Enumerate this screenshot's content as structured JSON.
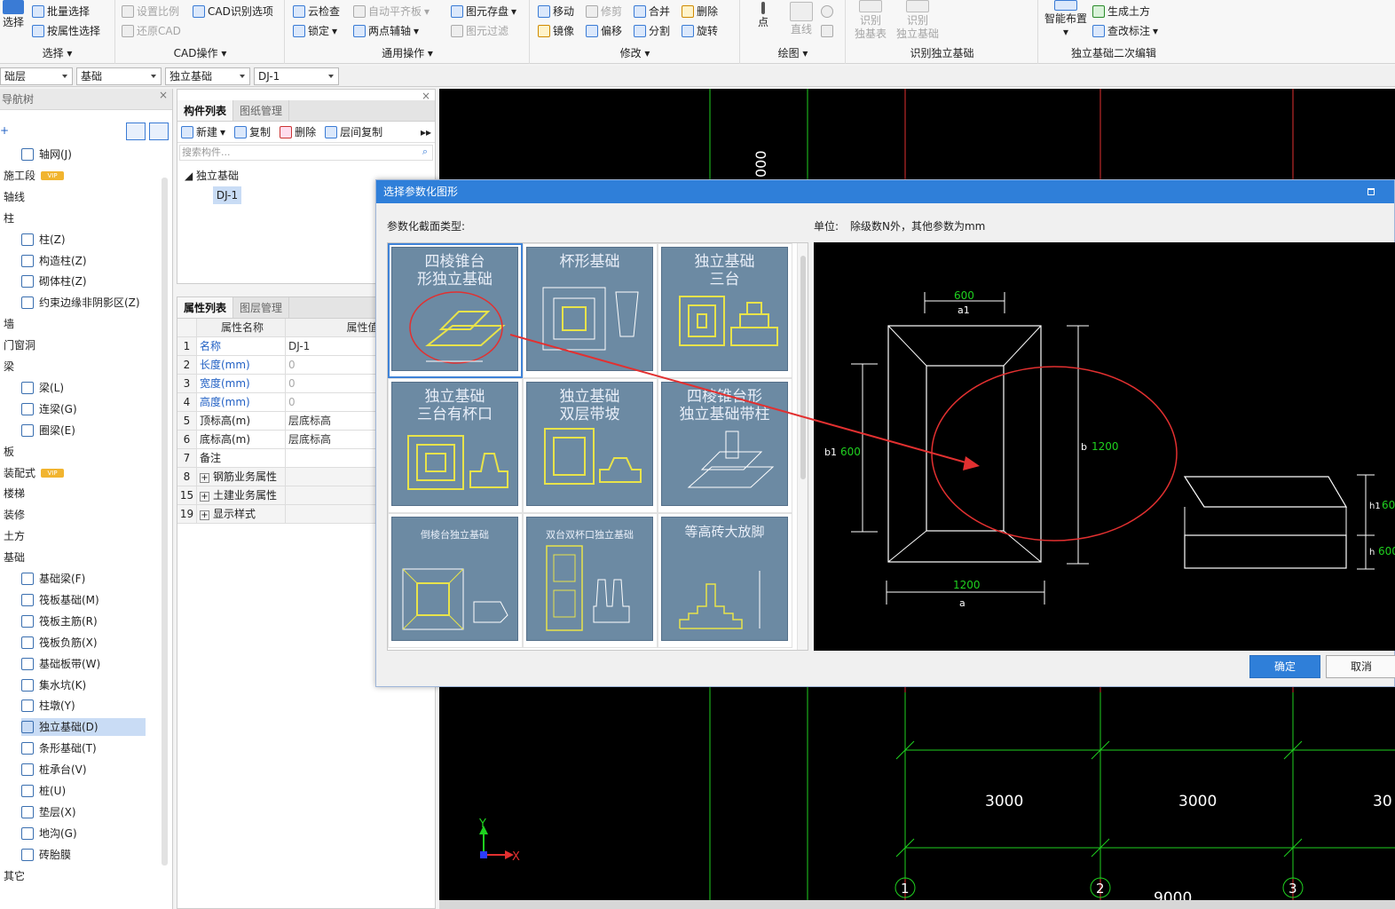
{
  "ribbon": {
    "select_group": {
      "title": "选择",
      "select_btn": "选择",
      "batch_select": "批量选择",
      "attr_select": "按属性选择"
    },
    "cad_group": {
      "title": "CAD操作",
      "set_ratio": "设置比例",
      "restore_cad": "还原CAD",
      "cad_options": "CAD识别选项"
    },
    "general_group": {
      "title": "通用操作",
      "cloud_check": "云检查",
      "lock": "锁定",
      "auto_level": "自动平齐板",
      "two_point_axis": "两点辅轴",
      "elem_save": "图元存盘",
      "elem_filter": "图元过滤"
    },
    "modify_group": {
      "title": "修改",
      "move": "移动",
      "trim": "修剪",
      "merge": "合并",
      "delete": "删除",
      "mirror": "镜像",
      "offset": "偏移",
      "split": "分割",
      "rotate": "旋转"
    },
    "draw_group": {
      "title": "绘图",
      "point": "点",
      "line": "直线"
    },
    "recognize_group": {
      "title": "识别独立基础",
      "rec_table_1": "识别",
      "rec_table_2": "独基表",
      "rec_found_1": "识别",
      "rec_found_2": "独立基础"
    },
    "edit2_group": {
      "title": "独立基础二次编辑",
      "smart_layout": "智能布置",
      "gen_earthwork": "生成土方",
      "check_label": "查改标注"
    }
  },
  "selectors": {
    "floor": "础层",
    "category": "基础",
    "type": "独立基础",
    "item": "DJ-1"
  },
  "nav_panel": {
    "title": "导航树",
    "items": [
      "轴网(J)",
      "施工段",
      "轴线",
      "柱",
      "柱(Z)",
      "构造柱(Z)",
      "砌体柱(Z)",
      "约束边缘非阴影区(Z)",
      "墙",
      "门窗洞",
      "梁",
      "梁(L)",
      "连梁(G)",
      "圈梁(E)",
      "板",
      "装配式",
      "楼梯",
      "装修",
      "土方",
      "基础",
      "基础梁(F)",
      "筏板基础(M)",
      "筏板主筋(R)",
      "筏板负筋(X)",
      "基础板带(W)",
      "集水坑(K)",
      "柱墩(Y)",
      "独立基础(D)",
      "条形基础(T)",
      "桩承台(V)",
      "桩(U)",
      "垫层(X)",
      "地沟(G)",
      "砖胎膜",
      "其它"
    ],
    "vip": "VIP"
  },
  "comp_panel": {
    "tab1": "构件列表",
    "tab2": "图纸管理",
    "new": "新建",
    "copy": "复制",
    "delete": "删除",
    "floor_copy": "层间复制",
    "search_placeholder": "搜索构件...",
    "tree_root": "独立基础",
    "tree_child": "DJ-1"
  },
  "prop_panel": {
    "tab1": "属性列表",
    "tab2": "图层管理",
    "col_name": "属性名称",
    "col_value": "属性值",
    "rows": [
      {
        "n": "1",
        "k": "名称",
        "v": "DJ-1"
      },
      {
        "n": "2",
        "k": "长度(mm)",
        "v": "0"
      },
      {
        "n": "3",
        "k": "宽度(mm)",
        "v": "0"
      },
      {
        "n": "4",
        "k": "高度(mm)",
        "v": "0"
      },
      {
        "n": "5",
        "k": "顶标高(m)",
        "v": "层底标高"
      },
      {
        "n": "6",
        "k": "底标高(m)",
        "v": "层底标高"
      },
      {
        "n": "7",
        "k": "备注",
        "v": ""
      },
      {
        "n": "8",
        "k": "钢筋业务属性",
        "v": ""
      },
      {
        "n": "15",
        "k": "土建业务属性",
        "v": ""
      },
      {
        "n": "19",
        "k": "显示样式",
        "v": ""
      }
    ]
  },
  "canvas": {
    "top_dim": "000",
    "bottom_dims": [
      "3000",
      "3000",
      "30"
    ],
    "bottom_total": "9000",
    "axis_labels": [
      "1",
      "2",
      "3"
    ],
    "axis_x": "X",
    "axis_y": "Y"
  },
  "dialog": {
    "title": "选择参数化图形",
    "section_label": "参数化截面类型:",
    "unit_label": "单位:",
    "unit_text": "除级数N外，其他参数为mm",
    "shapes": [
      {
        "t1": "四棱锥台",
        "t2": "形独立基础"
      },
      {
        "t1": "杯形基础",
        "t2": ""
      },
      {
        "t1": "独立基础",
        "t2": "三台"
      },
      {
        "t1": "独立基础",
        "t2": "三台有杯口"
      },
      {
        "t1": "独立基础",
        "t2": "双层带坡"
      },
      {
        "t1": "四棱锥台形",
        "t2": "独立基础带柱"
      },
      {
        "t1": "倒棱台独立基础",
        "t2": ""
      },
      {
        "t1": "双台双杯口独立基础",
        "t2": ""
      },
      {
        "t1": "等高砖大放脚",
        "t2": ""
      }
    ],
    "preview": {
      "top_val": "600",
      "top_var": "a1",
      "left_var": "b1",
      "left_val": "600",
      "right_var": "b",
      "right_val": "1200",
      "bottom_val": "1200",
      "bottom_var": "a",
      "h1_var": "h1",
      "h1_val": "60",
      "h_var": "h",
      "h_val": "600"
    },
    "ok": "确定",
    "cancel": "取消"
  },
  "colors": {
    "accent": "#2f7fd9",
    "cad_yellow": "#e8e34a",
    "cad_green": "#1fd11f",
    "annotation_red": "#e23030"
  }
}
